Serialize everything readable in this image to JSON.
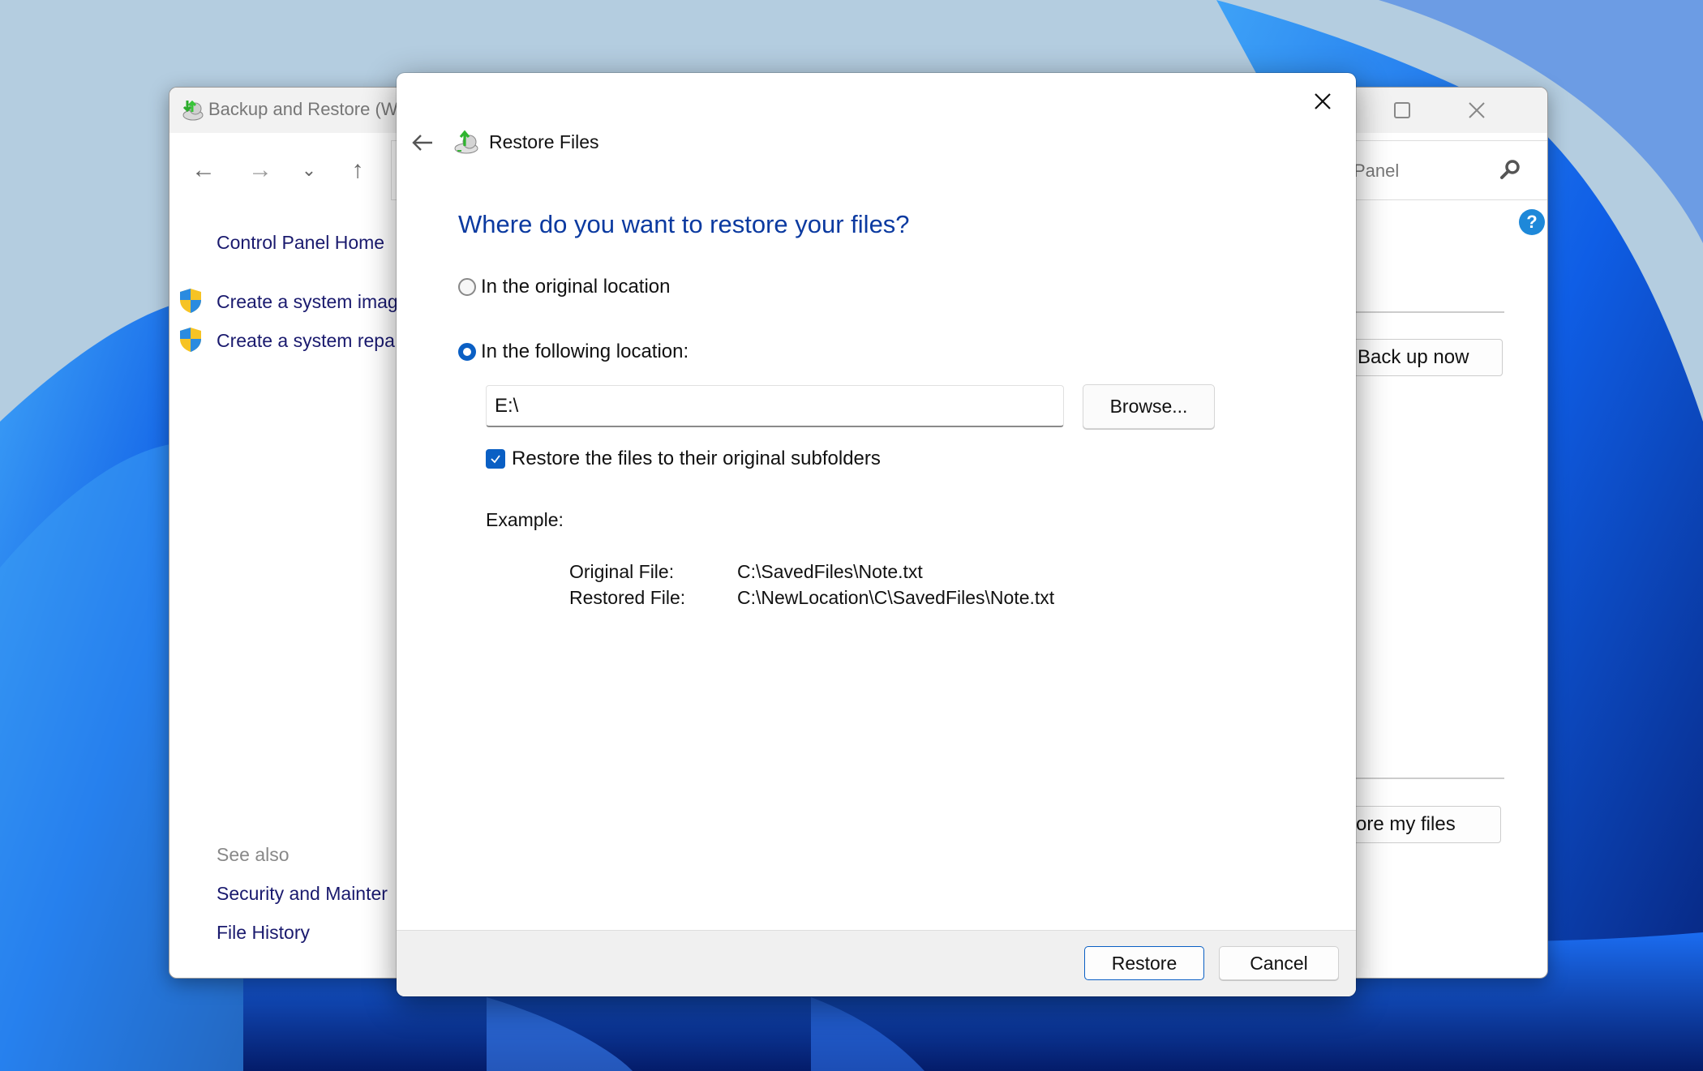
{
  "colors": {
    "accent": "#0a5fc4",
    "heading": "#0b3aa0",
    "link": "#1a1a6e",
    "wallpaper_sky": "#b4cde0",
    "wallpaper_blue": "#1560e0"
  },
  "background_window": {
    "title": "Backup and Restore (W",
    "nav": {
      "back_icon": "arrow-left-icon",
      "forward_icon": "arrow-right-icon",
      "recent_icon": "chevron-down-icon",
      "up_icon": "arrow-up-icon"
    },
    "search_text": "Panel",
    "sidebar": {
      "home_link": "Control Panel Home",
      "tasks": [
        {
          "label": "Create a system imag",
          "icon": "shield-icon"
        },
        {
          "label": "Create a system repa",
          "icon": "shield-icon"
        }
      ],
      "see_also_label": "See also",
      "see_also_links": [
        "Security and Mainter",
        "File History"
      ]
    },
    "main": {
      "back_up_now_label": "Back up now",
      "restore_my_files_label": "ore my files"
    },
    "window_controls": {
      "minimize": "minimize-icon",
      "maximize": "maximize-icon",
      "close": "close-icon"
    }
  },
  "dialog": {
    "title": "Restore Files",
    "heading": "Where do you want to restore your files?",
    "options": [
      {
        "label": "In the original location",
        "selected": false
      },
      {
        "label": "In the following location:",
        "selected": true
      }
    ],
    "location_value": "E:\\",
    "browse_label": "Browse...",
    "subfolders_checkbox": {
      "label": "Restore the files to their original subfolders",
      "checked": true
    },
    "example": {
      "label": "Example:",
      "rows": [
        {
          "label": "Original File:",
          "value": "C:\\SavedFiles\\Note.txt"
        },
        {
          "label": "Restored File:",
          "value": "C:\\NewLocation\\C\\SavedFiles\\Note.txt"
        }
      ]
    },
    "footer": {
      "restore_label": "Restore",
      "cancel_label": "Cancel"
    }
  }
}
